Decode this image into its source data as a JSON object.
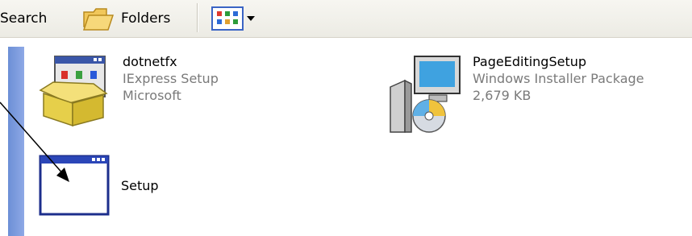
{
  "toolbar": {
    "search_label": "Search",
    "folders_label": "Folders"
  },
  "files": [
    {
      "name": "dotnetfx",
      "type": "IExpress Setup",
      "detail": "Microsoft",
      "icon": "iexpress-setup-icon"
    },
    {
      "name": "PageEditingSetup",
      "type": "Windows Installer Package",
      "detail": "2,679 KB",
      "icon": "windows-installer-icon"
    },
    {
      "name": "Setup",
      "icon": "application-window-icon"
    }
  ]
}
